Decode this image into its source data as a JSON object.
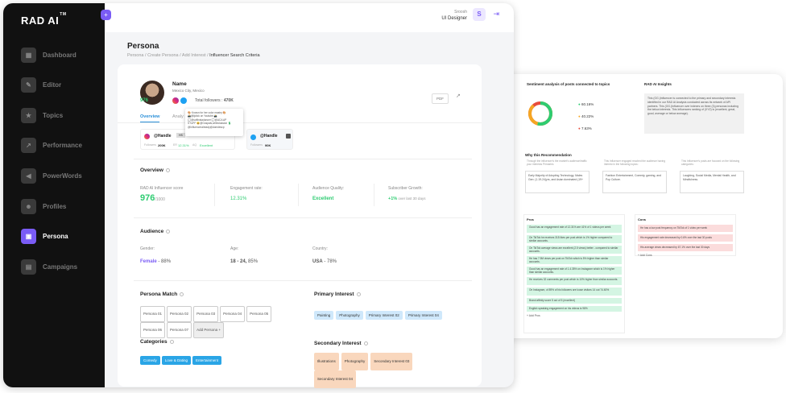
{
  "sidebar": {
    "logo": "RAD AI",
    "logo_sup": "TM",
    "items": [
      {
        "label": "Dashboard",
        "icon": "dashboard-icon",
        "glyph": "▦"
      },
      {
        "label": "Editor",
        "icon": "editor-icon",
        "glyph": "✎"
      },
      {
        "label": "Topics",
        "icon": "topics-icon",
        "glyph": "★"
      },
      {
        "label": "Performance",
        "icon": "performance-icon",
        "glyph": "↗"
      },
      {
        "label": "PowerWords",
        "icon": "powerwords-icon",
        "glyph": "◀"
      },
      {
        "label": "Profiles",
        "icon": "profiles-icon",
        "glyph": "☻"
      },
      {
        "label": "Persona",
        "icon": "persona-icon",
        "glyph": "▣"
      },
      {
        "label": "Campaigns",
        "icon": "campaigns-icon",
        "glyph": "▤"
      }
    ],
    "active": "Persona",
    "collapse_glyph": "+"
  },
  "topbar": {
    "user_name": "Sroosh",
    "user_role": "UI Designer",
    "avatar_letter": "S",
    "logout_glyph": "⇥"
  },
  "page": {
    "title": "Persona",
    "breadcrumb": [
      "Persona",
      "Create Persona",
      "Add Interest"
    ],
    "breadcrumb_current": "Influencer Search Criteria"
  },
  "profile": {
    "name": "Name",
    "location": "Mexico City, Mexico",
    "score_badge": "976",
    "followers_label": "Total followers :",
    "followers_value": "470K",
    "pdf": "PDF",
    "tabs": [
      "Overview",
      "Analy"
    ],
    "tooltip_lines": [
      "🎨 Known for her color mastry 🎨",
      "📸@ljclick on Youtube 📸",
      "💭@softinstadancer 💭@ACA AP",
      "STUFF 😆@Gospals,writeclassion 💲",
      "@Influenceralready@domdescp"
    ]
  },
  "handles": [
    {
      "name": "@Handle",
      "tag": "HS",
      "followers": "200K",
      "followers_label": "Followers",
      "er": "12.31%",
      "er_label": "ER",
      "quality": "Excellent",
      "quality_label": "AQ"
    },
    {
      "name": "@Handle",
      "followers": "90K",
      "followers_label": "Followers"
    }
  ],
  "overview": {
    "title": "Overview",
    "score_label": "RAD AI Influencer score",
    "score": "976",
    "score_max": "/1000",
    "er_label": "Engagement rate:",
    "er_value": "12.31%",
    "aq_label": "Audience Quality:",
    "aq_value": "Excellent",
    "growth_label": "Subscriber Growth:",
    "growth_value": "+1%",
    "growth_suffix": " over last 30 days"
  },
  "audience": {
    "title": "Audience",
    "gender_label": "Gender:",
    "gender_value": "Female",
    "gender_pct": " - 88%",
    "age_label": "Age:",
    "age_value": "18 - 24,",
    "age_pct": " 85%",
    "country_label": "Country:",
    "country_value": "USA",
    "country_pct": " - 78%"
  },
  "persona_match": {
    "title": "Persona Match",
    "items": [
      "Persona 01",
      "Persona 02",
      "Persona 03",
      "Persona 04",
      "Persona 05",
      "Persona 06",
      "Persona 07"
    ],
    "add": "Add Persona +"
  },
  "primary_interest": {
    "title": "Primary Interest",
    "items": [
      "Painting",
      "Photography",
      "Primary Interest 02",
      "Primary Interest 04"
    ]
  },
  "categories": {
    "title": "Categories",
    "items": [
      "Comedy",
      "Love & Dating",
      "Entertainment"
    ]
  },
  "secondary_interest": {
    "title": "Secondary Interest",
    "items": [
      "Illustrations",
      "Photography",
      "Secondary Interest 03",
      "Secondary Interest 04"
    ]
  },
  "back": {
    "sentiment_title": "Sentiment analysis of posts connected to topics",
    "sentiment": [
      {
        "label": "60.16%",
        "color": "#2ecc71"
      },
      {
        "label": "40.22%",
        "color": "#f5a623"
      },
      {
        "label": "7.63%",
        "color": "#e74c3c"
      }
    ],
    "insights_title": "RAD AI Insights",
    "insights_text": "This (OG.)Influencer is connected to the primary and secondary interests identified in our RAD AI Analysis conducted across its network of API partners. This (OG.)Influencer over indexes on three (3) personas including the below interests. This Influencers ranking of (XYZ) is (excellent, great, good, average or below average).",
    "why_title": "Why this Recommendation",
    "why_cols": [
      {
        "head": "Through the influencer's the market's audience/traffic your interests Primaries",
        "body": "Early Majority of Adopting Technology, Males Gen: (1.19-24)yrs, and Asian dominated (19+"
      },
      {
        "head": "This Influencer engaged reached the audience having interest in the following topics:",
        "body": "Fashion Entertainment, Comedy, gaming, and Pop Culture."
      },
      {
        "head": "This Influencer's posts are focused on the following categories:",
        "body": "Laughing, Social Media, Mental Health, and Mindfulness."
      }
    ],
    "pros_title": "Pros",
    "pros": [
      "Good has an engagement rate of 12.31% are 41% of 1 videos per week",
      "On TikTok he receives 315 likes per post which is 1% higher compared to similar accounts.",
      "On TikTok average views are excellent (2.5 views) better - compared to similar accounts.",
      "He has 7.9M views per post on TikTok which is 5% higher than similar accounts.",
      "Good has an engagement rate of 1.4.35% on Instagram which is 1% higher than similar accounts.",
      "He receives 32 comments per post which is 10% higher than similar accounts.",
      "On Instagram, of 89% of his followers are loose visitors 14 out 74.60%",
      "Brand affinity score 5 out of 5 (excellent)",
      "English speaking engagement on his videos is 98%"
    ],
    "pros_add": "+ Add Pros",
    "cons_title": "Cons",
    "cons": [
      "He has a low post frequency on TikTok of 1 video per week",
      "His engagement rate decreased by 0.6% over the last 30 posts",
      "His average views decreased by 67.1% over the last 30 days"
    ],
    "cons_add": "+ Add Cons"
  }
}
